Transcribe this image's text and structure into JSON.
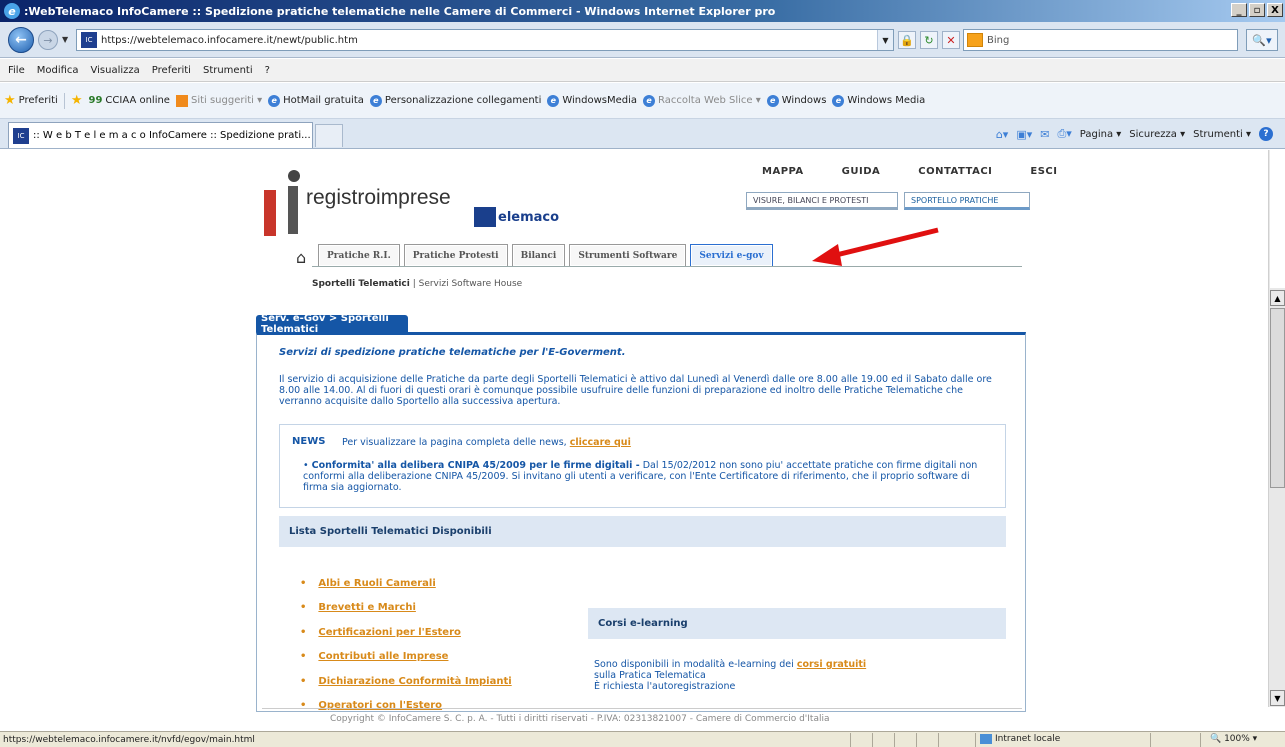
{
  "window": {
    "title": ":WebTelemaco InfoCamere :: Spedizione pratiche telematiche nelle Camere di Commerci - Windows Internet Explorer pro",
    "min": "_",
    "max": "▫",
    "close": "X"
  },
  "address": {
    "url": "https://webtelemaco.infocamere.it/newt/public.htm",
    "search_placeholder": "Bing"
  },
  "menu": [
    "File",
    "Modifica",
    "Visualizza",
    "Preferiti",
    "Strumenti",
    "?"
  ],
  "favorites": {
    "label": "Preferiti",
    "items": [
      {
        "label": "CCIAA online",
        "dim": false
      },
      {
        "label": "Siti suggeriti ▾",
        "dim": true
      },
      {
        "label": "HotMail gratuita",
        "dim": false
      },
      {
        "label": "Personalizzazione collegamenti",
        "dim": false
      },
      {
        "label": "WindowsMedia",
        "dim": false
      },
      {
        "label": "Raccolta Web Slice ▾",
        "dim": true
      },
      {
        "label": "Windows",
        "dim": false
      },
      {
        "label": "Windows Media",
        "dim": false
      }
    ]
  },
  "tab": {
    "title": ":: W e b T e l e m a c o InfoCamere :: Spedizione prati..."
  },
  "commands": [
    "Pagina ▾",
    "Sicurezza ▾",
    "Strumenti ▾"
  ],
  "site": {
    "logo_text": "registroimprese",
    "telemaco": "elemaco",
    "top_links": [
      "MAPPA",
      "GUIDA",
      "CONTATTACI",
      "ESCI"
    ],
    "top_tabs": [
      "VISURE, BILANCI E PROTESTI",
      "SPORTELLO PRATICHE"
    ],
    "nav_tabs": [
      "Pratiche R.I.",
      "Pratiche Protesti",
      "Bilanci",
      "Strumenti Software",
      "Servizi e-gov"
    ],
    "subnav_active": "Sportelli Telematici",
    "subnav_sep": " | ",
    "subnav_other": "Servizi Software House",
    "section_title": "Serv. e-Gov > Sportelli Telematici",
    "intro_title": "Servizi di spedizione pratiche telematiche per l'E-Goverment.",
    "intro_text": "Il servizio di acquisizione delle Pratiche da parte degli Sportelli Telematici è attivo dal Lunedì al Venerdì dalle ore 8.00 alle 19.00 ed il Sabato dalle ore 8.00 alle 14.00. Al di fuori di questi orari è comunque possibile usufruire delle funzioni di preparazione ed inoltro delle Pratiche Telematiche che verranno acquisite dallo Sportello alla successiva apertura.",
    "news_label": "NEWS",
    "news_lead": "Per visualizzare la pagina completa delle news,",
    "news_link": "cliccare qui",
    "news_item_title": "Conformita' alla delibera CNIPA 45/2009 per le firme digitali -",
    "news_item_text": "Dal 15/02/2012 non sono piu' accettate pratiche con firme digitali non conformi alla deliberazione CNIPA 45/2009. Si invitano gli utenti a verificare, con l'Ente Certificatore di riferimento, che il proprio software di firma sia aggiornato.",
    "list_header": "Lista Sportelli Telematici Disponibili",
    "list_items": [
      "Albi e Ruoli Camerali",
      "Brevetti e Marchi",
      "Certificazioni per l'Estero",
      "Contributi alle Imprese",
      "Dichiarazione Conformità Impianti",
      "Operatori con l'Estero"
    ],
    "elearn_header": "Corsi e-learning",
    "elearn_line1a": "Sono disponibili in modalità e-learning dei",
    "elearn_link": "corsi gratuiti",
    "elearn_line2": "sulla Pratica Telematica",
    "elearn_line3": "È richiesta l'autoregistrazione",
    "copyright": "Copyright © InfoCamere S. C. p. A. - Tutti i diritti riservati - P.IVA: 02313821007 - Camere di Commercio d'Italia"
  },
  "status": {
    "url": "https://webtelemaco.infocamere.it/nvfd/egov/main.html",
    "zone": "Intranet locale",
    "zoom": "100%"
  }
}
